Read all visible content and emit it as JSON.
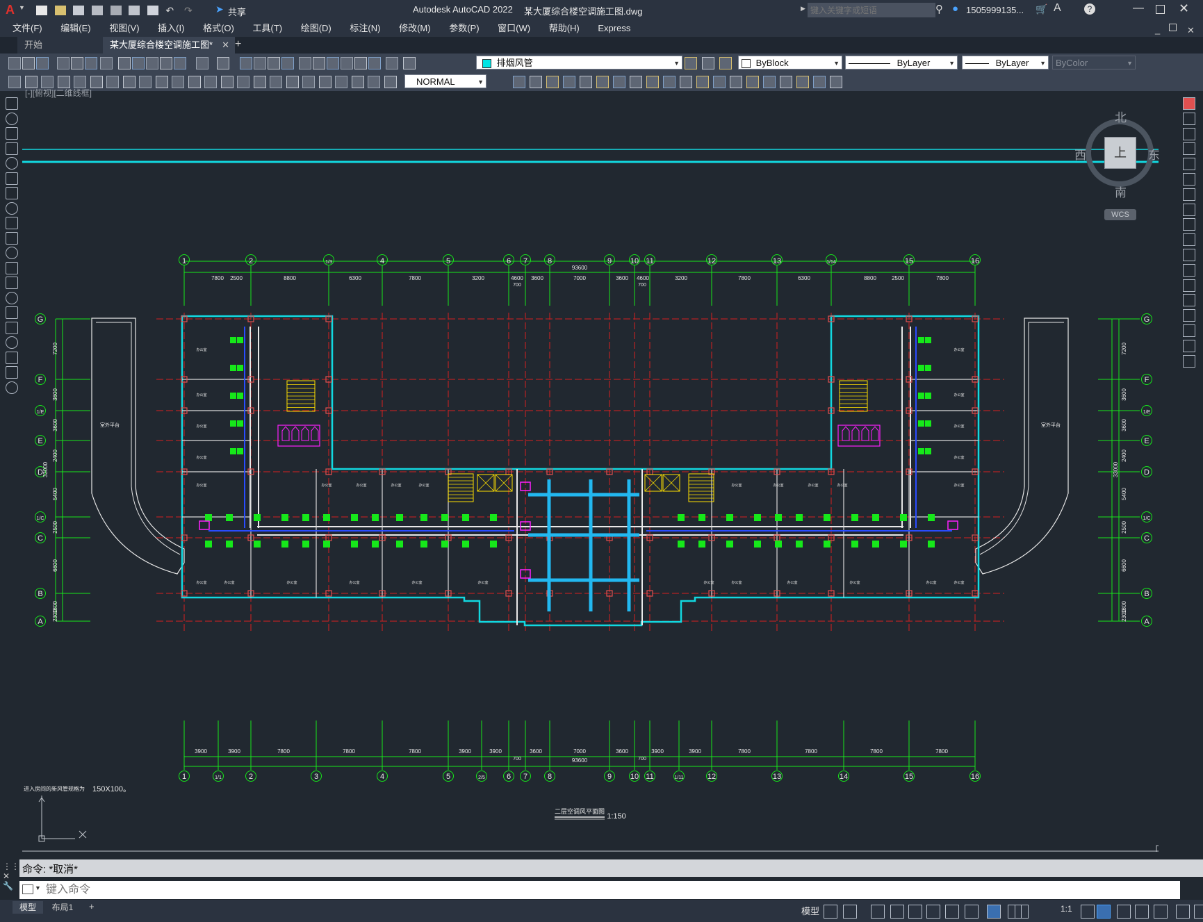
{
  "app": {
    "title": "Autodesk AutoCAD 2022",
    "file": "某大厦综合楼空调施工图.dwg",
    "share": "共享",
    "search_placeholder": "键入关键字或短语",
    "user": "1505999135...",
    "logo": "A"
  },
  "menu": [
    "文件(F)",
    "编辑(E)",
    "视图(V)",
    "插入(I)",
    "格式(O)",
    "工具(T)",
    "绘图(D)",
    "标注(N)",
    "修改(M)",
    "参数(P)",
    "窗口(W)",
    "帮助(H)",
    "Express"
  ],
  "tabs": {
    "start": "开始",
    "active": "某大厦综合楼空调施工图*",
    "close_icon": "close-icon",
    "add_icon": "plus-icon"
  },
  "toolbar": {
    "layer": "排烟风管",
    "color": "ByBlock",
    "linetype": "ByLayer",
    "lineweight": "ByLayer",
    "plotstyle": "ByColor",
    "dimstyle": "NORMAL"
  },
  "viewport": {
    "label": "[-][俯视][二维线框]",
    "compass": {
      "north": "北",
      "south": "南",
      "east": "东",
      "west": "西",
      "top": "上"
    },
    "wcs": "WCS"
  },
  "drawing": {
    "top_axes": [
      "1",
      "2",
      "1/3",
      "4",
      "5",
      "6",
      "7",
      "8",
      "9",
      "10",
      "11",
      "12",
      "13",
      "1/14",
      "15",
      "16"
    ],
    "top_dims": [
      "7800",
      "2500",
      "8800",
      "6300",
      "7800",
      "3200",
      "4600",
      "3600",
      "7000",
      "3600",
      "4600",
      "3200",
      "7800",
      "6300",
      "8800",
      "2500",
      "7800"
    ],
    "overall": "93600",
    "gap": "700",
    "bottom_axes": [
      "1",
      "1/1",
      "2",
      "3",
      "4",
      "5",
      "2/5",
      "6",
      "7",
      "8",
      "9",
      "10",
      "11",
      "1/11",
      "12",
      "13",
      "14",
      "15",
      "16"
    ],
    "bottom_dims": [
      "3900",
      "3900",
      "7800",
      "7800",
      "7800",
      "3900",
      "3900",
      "3600",
      "7000",
      "3600",
      "3900",
      "3900",
      "7800",
      "7800",
      "7800",
      "7800"
    ],
    "row_axes": [
      "G",
      "F",
      "1/E",
      "E",
      "D",
      "1/C",
      "C",
      "B",
      "A"
    ],
    "row_dims": [
      "7200",
      "3600",
      "3600",
      "2400",
      "5400",
      "2500",
      "6600",
      "1800",
      "2300"
    ],
    "total_height": "33000",
    "left_wing_label": "室外平台",
    "right_wing_label": "室外平台",
    "room_label": "办公室",
    "note_left": "进入房间的新风管规格为",
    "note_left_size": "150X100。",
    "plan_title": "二层空调风平面图",
    "scale": "1:150"
  },
  "command": {
    "history": "命令: *取消*",
    "placeholder": "键入命令"
  },
  "status": {
    "model_tab": "模型",
    "layout_tab": "布局1",
    "add_icon": "plus-icon",
    "model": "模型",
    "scale": "1:1"
  }
}
